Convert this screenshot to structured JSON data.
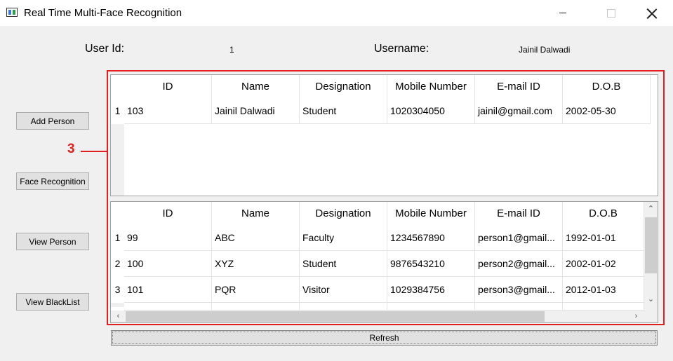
{
  "window": {
    "title": "Real Time Multi-Face Recognition",
    "app_icon": "app-window-icon",
    "controls": [
      "minimize-icon",
      "maximize-icon",
      "close-icon"
    ]
  },
  "info": {
    "user_id_label": "User Id:",
    "user_id_value": "1",
    "username_label": "Username:",
    "username_value": "Jainil Dalwadi"
  },
  "buttons": {
    "add_person": "Add Person",
    "face_recognition": "Face Recognition",
    "view_person": "View Person",
    "view_blacklist": "View BlackList",
    "refresh": "Refresh"
  },
  "annotation": {
    "number": "3",
    "color": "#e02020"
  },
  "table_top": {
    "columns": [
      "ID",
      "Name",
      "Designation",
      "Mobile Number",
      "E-mail ID",
      "D.O.B"
    ],
    "rows": [
      {
        "index": "1",
        "cells": [
          "103",
          "Jainil Dalwadi",
          "Student",
          "1020304050",
          "jainil@gmail.com",
          "2002-05-30"
        ]
      }
    ]
  },
  "table_bottom": {
    "columns": [
      "ID",
      "Name",
      "Designation",
      "Mobile Number",
      "E-mail ID",
      "D.O.B"
    ],
    "rows": [
      {
        "index": "1",
        "cells": [
          "99",
          "ABC",
          "Faculty",
          "1234567890",
          "person1@gmail...",
          "1992-01-01"
        ]
      },
      {
        "index": "2",
        "cells": [
          "100",
          "XYZ",
          "Student",
          "9876543210",
          "person2@gmail...",
          "2002-01-02"
        ]
      },
      {
        "index": "3",
        "cells": [
          "101",
          "PQR",
          "Visitor",
          "1029384756",
          "person3@gmail...",
          "2012-01-03"
        ]
      }
    ],
    "scroll_icons": [
      "scroll-up-icon",
      "scroll-down-icon",
      "scroll-left-icon",
      "scroll-right-icon"
    ]
  }
}
